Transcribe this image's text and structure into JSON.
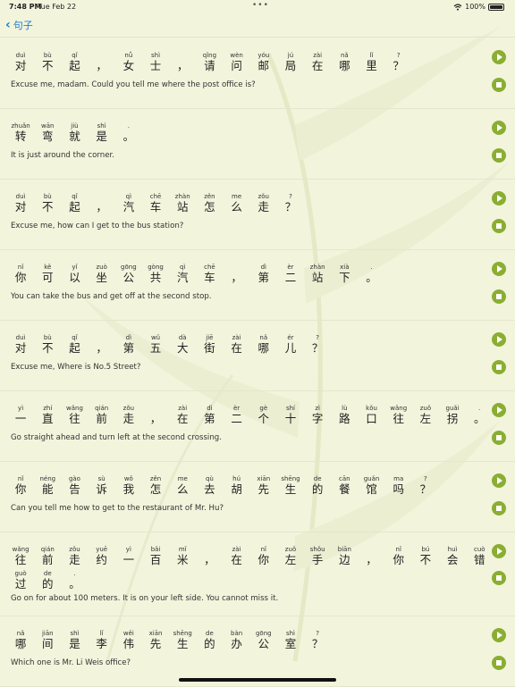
{
  "status": {
    "time": "7:48 PM",
    "date": "Tue Feb 22",
    "battery": "100%"
  },
  "nav": {
    "back_label": "句子"
  },
  "sentences": [
    {
      "lines": [
        [
          [
            "duì",
            "对"
          ],
          [
            "bù",
            "不"
          ],
          [
            "qǐ",
            "起"
          ],
          [
            "",
            "，"
          ],
          [
            "nǚ",
            "女"
          ],
          [
            "shì",
            "士"
          ],
          [
            "",
            "，"
          ],
          [
            "qǐng",
            "请"
          ],
          [
            "wèn",
            "问"
          ],
          [
            "yóu",
            "邮"
          ],
          [
            "jú",
            "局"
          ],
          [
            "zài",
            "在"
          ],
          [
            "nǎ",
            "哪"
          ],
          [
            "lǐ",
            "里"
          ],
          [
            "?",
            "？"
          ]
        ]
      ],
      "english": "Excuse me, madam. Could you tell me where the post office is?"
    },
    {
      "lines": [
        [
          [
            "zhuǎn",
            "转"
          ],
          [
            "wān",
            "弯"
          ],
          [
            "jiù",
            "就"
          ],
          [
            "shì",
            "是"
          ],
          [
            ".",
            "。"
          ]
        ]
      ],
      "english": "It is just around the corner."
    },
    {
      "lines": [
        [
          [
            "duì",
            "对"
          ],
          [
            "bù",
            "不"
          ],
          [
            "qǐ",
            "起"
          ],
          [
            "",
            "，"
          ],
          [
            "qì",
            "汽"
          ],
          [
            "chē",
            "车"
          ],
          [
            "zhàn",
            "站"
          ],
          [
            "zěn",
            "怎"
          ],
          [
            "me",
            "么"
          ],
          [
            "zǒu",
            "走"
          ],
          [
            "?",
            "？"
          ]
        ]
      ],
      "english": "Excuse me, how can I get to the bus station?"
    },
    {
      "lines": [
        [
          [
            "nǐ",
            "你"
          ],
          [
            "kě",
            "可"
          ],
          [
            "yǐ",
            "以"
          ],
          [
            "zuò",
            "坐"
          ],
          [
            "gōng",
            "公"
          ],
          [
            "gòng",
            "共"
          ],
          [
            "qì",
            "汽"
          ],
          [
            "chē",
            "车"
          ],
          [
            "",
            "，"
          ],
          [
            "dì",
            "第"
          ],
          [
            "èr",
            "二"
          ],
          [
            "zhàn",
            "站"
          ],
          [
            "xià",
            "下"
          ],
          [
            ".",
            "。"
          ]
        ]
      ],
      "english": "You can take the bus and get off at the second stop."
    },
    {
      "lines": [
        [
          [
            "duì",
            "对"
          ],
          [
            "bù",
            "不"
          ],
          [
            "qǐ",
            "起"
          ],
          [
            "",
            "，"
          ],
          [
            "dì",
            "第"
          ],
          [
            "wǔ",
            "五"
          ],
          [
            "dà",
            "大"
          ],
          [
            "jiē",
            "街"
          ],
          [
            "zài",
            "在"
          ],
          [
            "nǎ",
            "哪"
          ],
          [
            "ér",
            "儿"
          ],
          [
            "?",
            "？"
          ]
        ]
      ],
      "english": "Excuse me, Where is No.5 Street?"
    },
    {
      "lines": [
        [
          [
            "yì",
            "一"
          ],
          [
            "zhí",
            "直"
          ],
          [
            "wǎng",
            "往"
          ],
          [
            "qián",
            "前"
          ],
          [
            "zǒu",
            "走"
          ],
          [
            "",
            "，"
          ],
          [
            "zài",
            "在"
          ],
          [
            "dì",
            "第"
          ],
          [
            "èr",
            "二"
          ],
          [
            "gè",
            "个"
          ],
          [
            "shí",
            "十"
          ],
          [
            "zì",
            "字"
          ],
          [
            "lù",
            "路"
          ],
          [
            "kǒu",
            "口"
          ],
          [
            "wǎng",
            "往"
          ],
          [
            "zuǒ",
            "左"
          ],
          [
            "guǎi",
            "拐"
          ],
          [
            ".",
            "。"
          ]
        ]
      ],
      "english": "Go straight ahead and turn left at the second crossing."
    },
    {
      "lines": [
        [
          [
            "nǐ",
            "你"
          ],
          [
            "néng",
            "能"
          ],
          [
            "gào",
            "告"
          ],
          [
            "sù",
            "诉"
          ],
          [
            "wǒ",
            "我"
          ],
          [
            "zěn",
            "怎"
          ],
          [
            "me",
            "么"
          ],
          [
            "qù",
            "去"
          ],
          [
            "hú",
            "胡"
          ],
          [
            "xiān",
            "先"
          ],
          [
            "shēng",
            "生"
          ],
          [
            "de",
            "的"
          ],
          [
            "cān",
            "餐"
          ],
          [
            "guǎn",
            "馆"
          ],
          [
            "ma",
            "吗"
          ],
          [
            "?",
            "？"
          ]
        ]
      ],
      "english": "Can you tell me how to get to the restaurant of Mr. Hu?"
    },
    {
      "lines": [
        [
          [
            "wǎng",
            "往"
          ],
          [
            "qián",
            "前"
          ],
          [
            "zǒu",
            "走"
          ],
          [
            "yuē",
            "约"
          ],
          [
            "yì",
            "一"
          ],
          [
            "bǎi",
            "百"
          ],
          [
            "mǐ",
            "米"
          ],
          [
            "",
            "，"
          ],
          [
            "zài",
            "在"
          ],
          [
            "nǐ",
            "你"
          ],
          [
            "zuǒ",
            "左"
          ],
          [
            "shǒu",
            "手"
          ],
          [
            "biān",
            "边"
          ],
          [
            "",
            "，"
          ],
          [
            "nǐ",
            "你"
          ],
          [
            "bú",
            "不"
          ],
          [
            "huì",
            "会"
          ],
          [
            "cuò",
            "错"
          ]
        ],
        [
          [
            "guò",
            "过"
          ],
          [
            "de",
            "的"
          ],
          [
            ".",
            "。"
          ]
        ]
      ],
      "english": "Go on for about 100 meters. It is on your left side. You cannot miss it."
    },
    {
      "lines": [
        [
          [
            "nǎ",
            "哪"
          ],
          [
            "jiān",
            "间"
          ],
          [
            "shì",
            "是"
          ],
          [
            "lǐ",
            "李"
          ],
          [
            "wěi",
            "伟"
          ],
          [
            "xiān",
            "先"
          ],
          [
            "shēng",
            "生"
          ],
          [
            "de",
            "的"
          ],
          [
            "bàn",
            "办"
          ],
          [
            "gōng",
            "公"
          ],
          [
            "shì",
            "室"
          ],
          [
            "?",
            "？"
          ]
        ]
      ],
      "english": "Which one is Mr. Li Weis office?"
    }
  ]
}
